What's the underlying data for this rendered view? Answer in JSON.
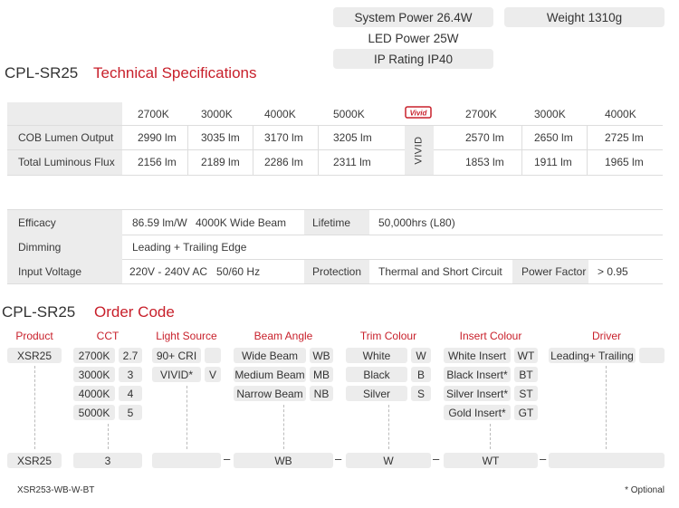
{
  "summary": {
    "system_power_label": "System Power",
    "system_power_value": "26.4W",
    "weight_label": "Weight",
    "weight_value": "1310g",
    "led_power_label": "LED Power",
    "led_power_value": "25W",
    "ip_label": "IP Rating",
    "ip_value": "IP40"
  },
  "tech": {
    "model": "CPL-SR25",
    "title": "Technical Specifications",
    "cct_headers": [
      "2700K",
      "3000K",
      "4000K",
      "5000K"
    ],
    "vivid_badge": "Vivid",
    "vivid_label": "VIVID",
    "vivid_headers": [
      "2700K",
      "3000K",
      "4000K"
    ],
    "rows": [
      {
        "label": "COB Lumen Output",
        "values": [
          "2990 lm",
          "3035 lm",
          "3170 lm",
          "3205 lm"
        ],
        "vivid": [
          "2570 lm",
          "2650 lm",
          "2725 lm"
        ]
      },
      {
        "label": "Total Luminous Flux",
        "values": [
          "2156 lm",
          "2189 lm",
          "2286 lm",
          "2311 lm"
        ],
        "vivid": [
          "1853 lm",
          "1911 lm",
          "1965 lm"
        ]
      }
    ]
  },
  "specs": {
    "efficacy_label": "Efficacy",
    "efficacy_value": "86.59 lm/W",
    "efficacy_note": "4000K Wide Beam",
    "lifetime_label": "Lifetime",
    "lifetime_value": "50,000hrs (L80)",
    "dimming_label": "Dimming",
    "dimming_value": "Leading + Trailing Edge",
    "input_label": "Input Voltage",
    "input_value": "220V - 240V AC   50/60 Hz",
    "protection_label": "Protection",
    "protection_value": "Thermal and Short Circuit",
    "pf_label": "Power Factor",
    "pf_value": "> 0.95"
  },
  "order": {
    "model": "CPL-SR25",
    "title": "Order Code",
    "headers": {
      "product": "Product",
      "cct": "CCT",
      "light_source": "Light Source",
      "beam_angle": "Beam Angle",
      "trim_colour": "Trim Colour",
      "insert_colour": "Insert Colour",
      "driver": "Driver"
    },
    "product": [
      "XSR25"
    ],
    "cct": [
      {
        "name": "2700K",
        "code": "2.7"
      },
      {
        "name": "3000K",
        "code": "3"
      },
      {
        "name": "4000K",
        "code": "4"
      },
      {
        "name": "5000K",
        "code": "5"
      }
    ],
    "light_source": [
      {
        "name": "90+ CRI",
        "code": ""
      },
      {
        "name": "VIVID*",
        "code": "V"
      }
    ],
    "beam_angle": [
      {
        "name": "Wide Beam",
        "code": "WB"
      },
      {
        "name": "Medium Beam",
        "code": "MB"
      },
      {
        "name": "Narrow Beam",
        "code": "NB"
      }
    ],
    "trim_colour": [
      {
        "name": "White",
        "code": "W"
      },
      {
        "name": "Black",
        "code": "B"
      },
      {
        "name": "Silver",
        "code": "S"
      }
    ],
    "insert_colour": [
      {
        "name": "White Insert",
        "code": "WT"
      },
      {
        "name": "Black Insert*",
        "code": "BT"
      },
      {
        "name": "Silver Insert*",
        "code": "ST"
      },
      {
        "name": "Gold Insert*",
        "code": "GT"
      }
    ],
    "driver": [
      {
        "name": "Leading+ Trailing",
        "code": ""
      }
    ],
    "result": {
      "product": "XSR25",
      "cct": "3",
      "light_source": "",
      "beam_angle": "WB",
      "trim_colour": "W",
      "insert_colour": "WT",
      "driver": ""
    },
    "separator": "–",
    "example": "XSR253-WB-W-BT",
    "footnote": "* Optional"
  },
  "colors": {
    "accent": "#c8202b",
    "box": "#ececec",
    "text": "#333333"
  }
}
